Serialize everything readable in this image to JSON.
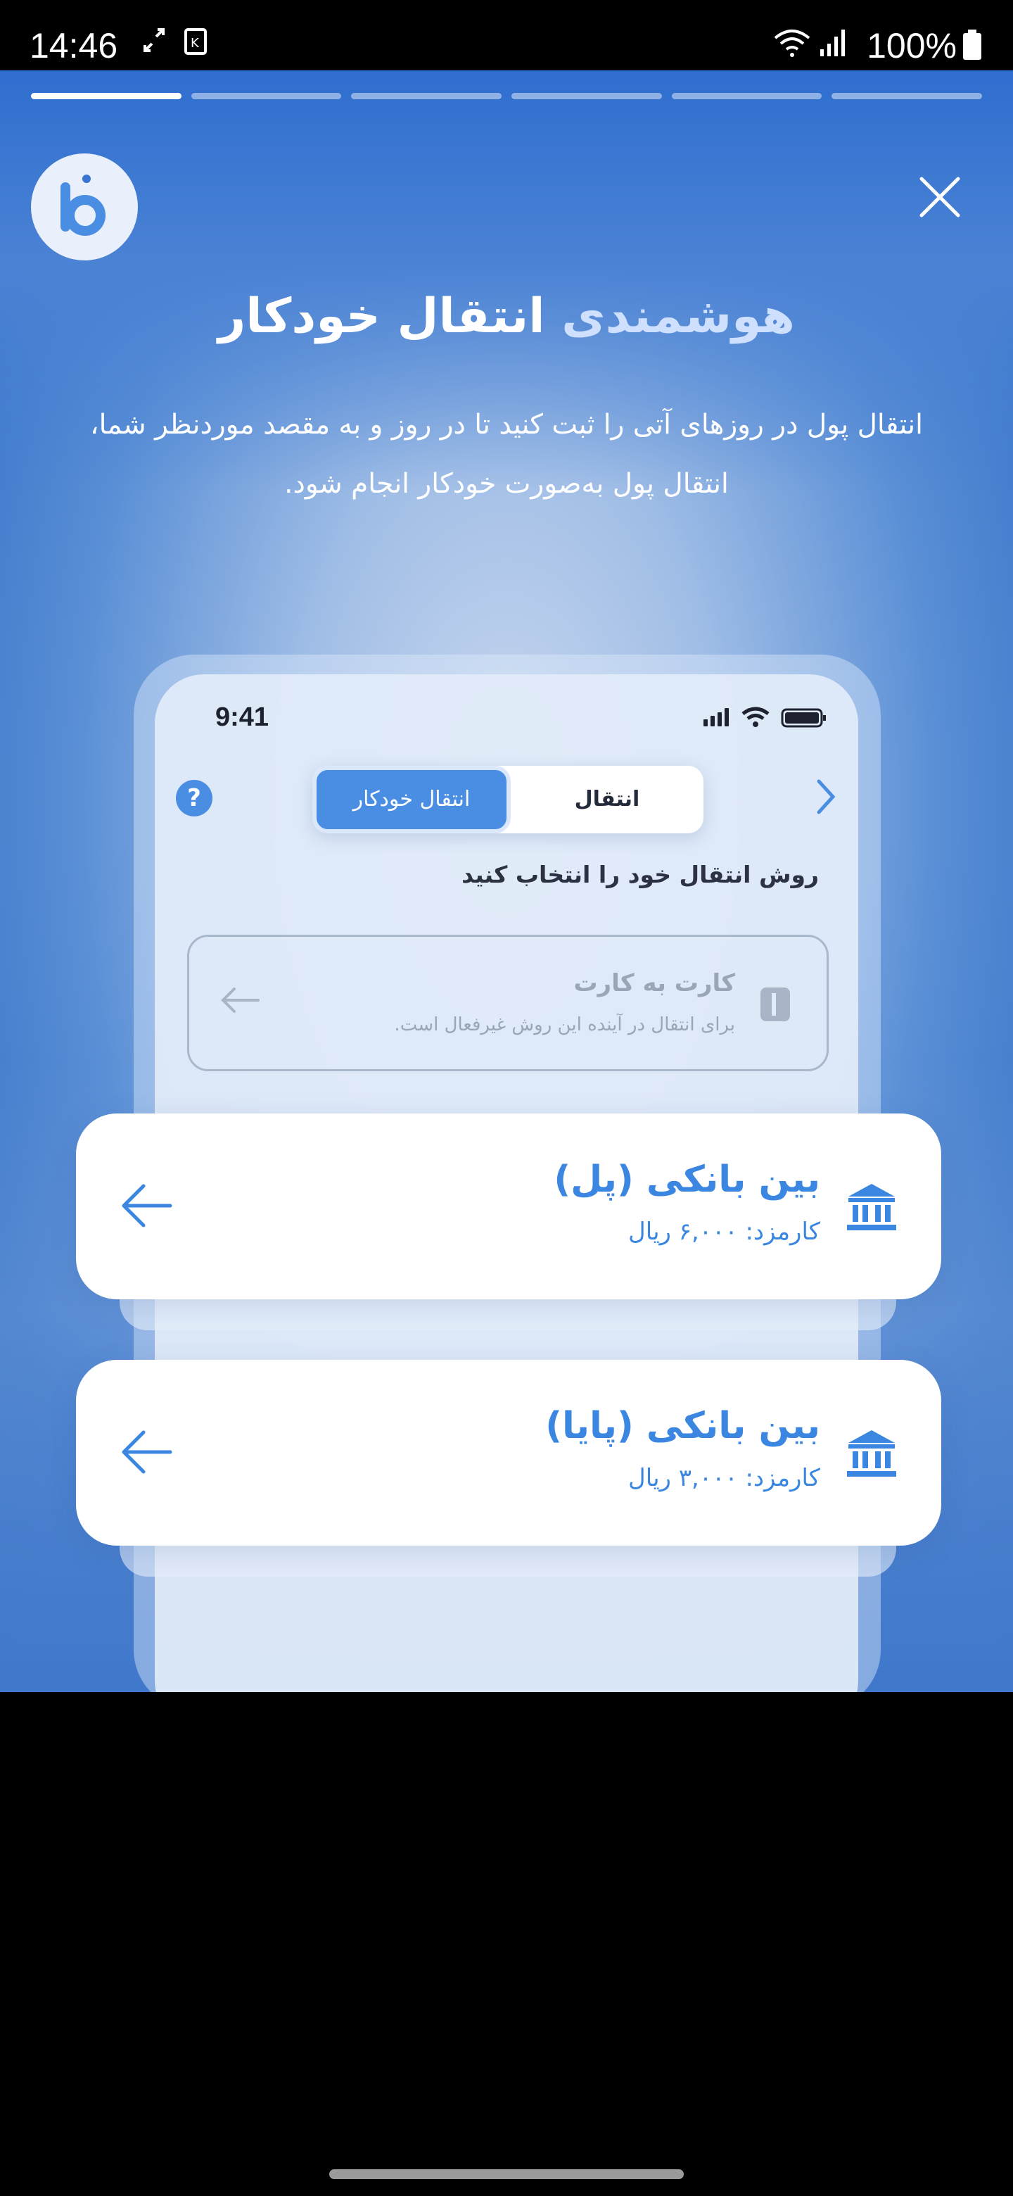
{
  "status_bar": {
    "time": "14:46",
    "battery": "100%"
  },
  "story": {
    "progress": {
      "total_segments": 6,
      "active_index": 0
    },
    "headline_highlight": "هوشمندی",
    "headline_main": "انتقال خودکار",
    "description_line1": "انتقال پول در روزهای آتی را ثبت کنید تا در روز و به مقصد موردنظر شما،",
    "description_line2": "انتقال پول به‌صورت خودکار انجام شود."
  },
  "mock_phone": {
    "time": "9:41",
    "tab_auto": "انتقال خودکار",
    "tab_transfer": "انتقال",
    "help": "?",
    "prompt": "روش انتقال خود را انتخاب کنید",
    "card_to_card": {
      "title": "کارت به کارت",
      "subtitle": "برای انتقال در آینده این روش غیرفعال است."
    }
  },
  "bank_options": [
    {
      "title": "بین بانکی (پل)",
      "fee": "کارمزد: ۶,۰۰۰ ریال"
    },
    {
      "title": "بین بانکی (پایا)",
      "fee": "کارمزد: ۳,۰۰۰ ریال"
    }
  ],
  "colors": {
    "accent": "#3a86e0",
    "story_top": "#2f6ed0"
  }
}
